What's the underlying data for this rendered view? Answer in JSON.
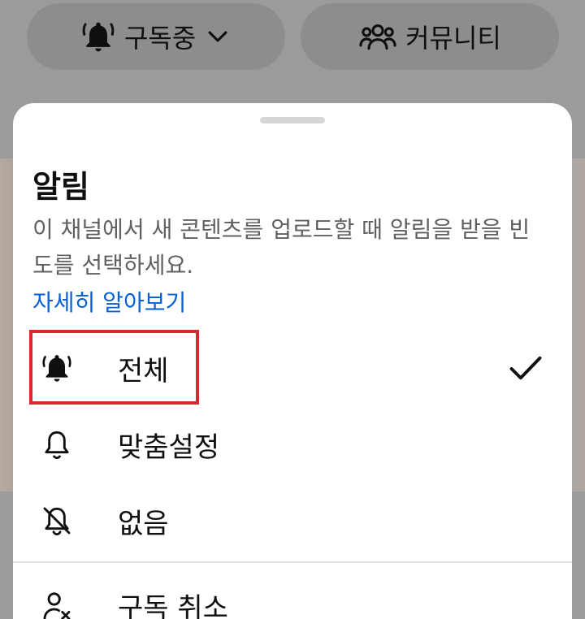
{
  "header": {
    "subscribe_label": "구독중",
    "community_label": "커뮤니티"
  },
  "sheet": {
    "title": "알림",
    "description": "이 채널에서 새 콘텐츠를 업로드할 때 알림을 받을 빈도를 선택하세요.",
    "learn_more": "자세히 알아보기",
    "options": [
      {
        "label": "전체",
        "icon": "bell-ringing-icon",
        "selected": true
      },
      {
        "label": "맞춤설정",
        "icon": "bell-icon",
        "selected": false
      },
      {
        "label": "없음",
        "icon": "bell-off-icon",
        "selected": false
      }
    ],
    "unsubscribe_label": "구독 취소",
    "unsubscribe_icon": "person-remove-icon"
  },
  "colors": {
    "link": "#065fd4",
    "highlight_box": "#d8282f"
  }
}
